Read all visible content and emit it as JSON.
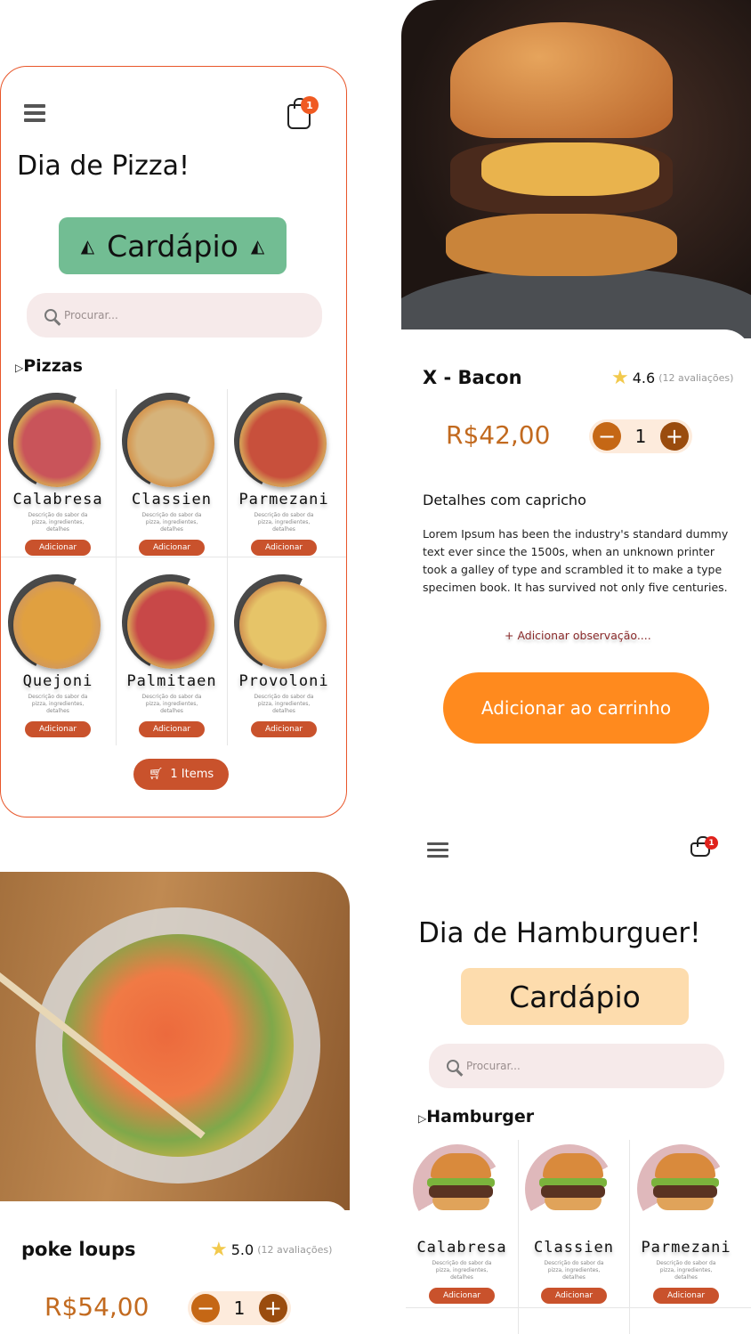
{
  "pizza_screen": {
    "cart_count": "1",
    "title": "Dia de Pizza!",
    "menu_label": "Cardápio",
    "search_placeholder": "Procurar...",
    "section": "Pizzas",
    "section_icon": "triangle-right-icon",
    "items": [
      {
        "name": "Calabresa",
        "desc": "Descrição do sabor da pizza, ingredientes, detalhes",
        "button": "Adicionar"
      },
      {
        "name": "Classien",
        "desc": "Descrição do sabor da pizza, ingredientes, detalhes",
        "button": "Adicionar"
      },
      {
        "name": "Parmezani",
        "desc": "Descrição do sabor da pizza, ingredientes, detalhes",
        "button": "Adicionar"
      },
      {
        "name": "Quejoni",
        "desc": "Descrição do sabor da pizza, ingredientes, detalhes",
        "button": "Adicionar"
      },
      {
        "name": "Palmitaen",
        "desc": "Descrição do sabor da pizza, ingredientes, detalhes",
        "button": "Adicionar"
      },
      {
        "name": "Provoloni",
        "desc": "Descrição do sabor da pizza, ingredientes, detalhes",
        "button": "Adicionar"
      }
    ],
    "cart_button": "1 Items",
    "colors": {
      "border": "#e8562a",
      "menu_bg": "#72bd93",
      "button": "#c9522c"
    }
  },
  "burger_detail": {
    "name": "X - Bacon",
    "rating": "4.6",
    "reviews": "(12 avaliações)",
    "price": "R$42,00",
    "quantity": "1",
    "details_title": "Detalhes com capricho",
    "details_text": "Lorem Ipsum has been the industry's standard dummy text ever since the 1500s, when an unknown printer took a galley of type and scrambled it to make a type specimen book. It has survived not only five centuries.",
    "add_note": "+ Adicionar observação....",
    "add_to_cart": "Adicionar ao carrinho",
    "colors": {
      "price": "#c26a1f",
      "cta": "#ff8a1e"
    }
  },
  "poke_detail": {
    "name": "poke loups",
    "rating": "5.0",
    "reviews": "(12 avaliações)",
    "price": "R$54,00",
    "quantity": "1"
  },
  "hamburger_screen": {
    "cart_count": "1",
    "title": "Dia de Hamburguer!",
    "menu_label": "Cardápio",
    "search_placeholder": "Procurar...",
    "section": "Hamburger",
    "items": [
      {
        "name": "Calabresa",
        "desc": "Descrição do sabor da pizza, ingredientes, detalhes",
        "button": "Adicionar"
      },
      {
        "name": "Classien",
        "desc": "Descrição do sabor da pizza, ingredientes, detalhes",
        "button": "Adicionar"
      },
      {
        "name": "Parmezani",
        "desc": "Descrição do sabor da pizza, ingredientes, detalhes",
        "button": "Adicionar"
      }
    ],
    "colors": {
      "menu_bg": "#fddcad",
      "arc": "#dfb8bb"
    }
  }
}
